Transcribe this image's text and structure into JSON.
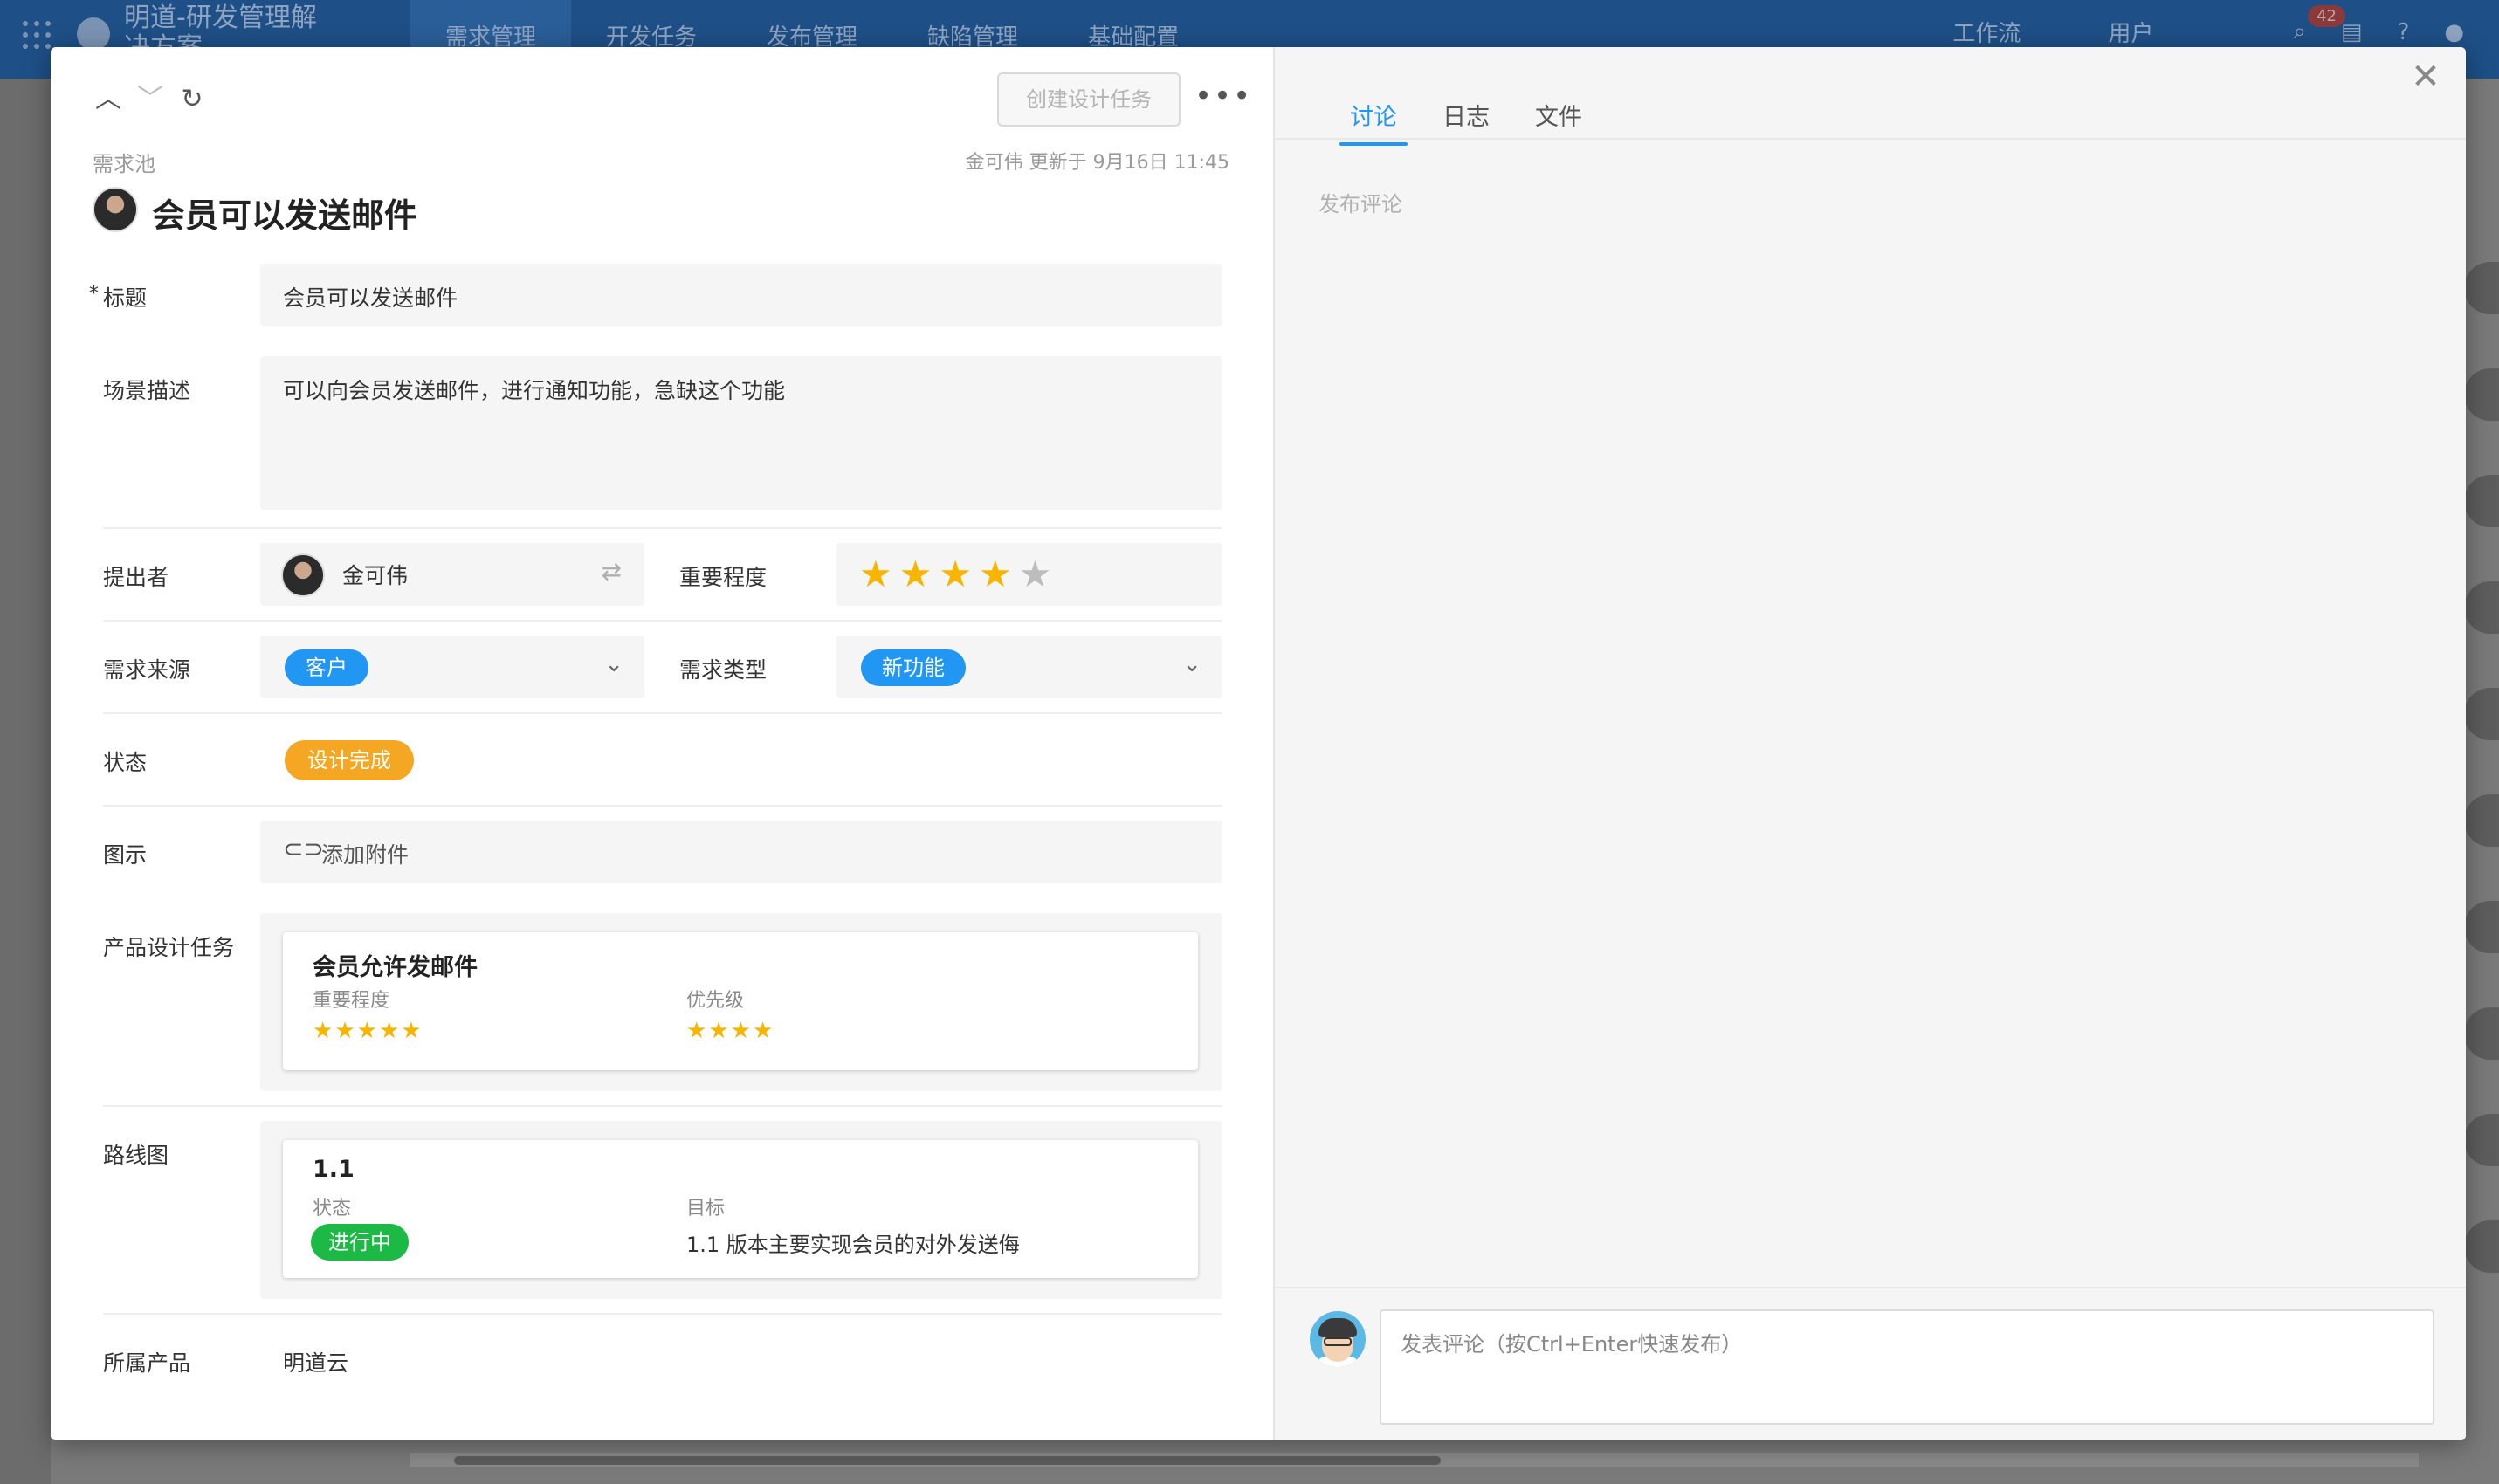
{
  "background_app": {
    "title": "明道-研发管理解决方案",
    "nav": [
      "需求管理",
      "开发任务",
      "发布管理",
      "缺陷管理",
      "基础配置"
    ],
    "right": {
      "workflow": "工作流",
      "users": "用户",
      "badge": "42"
    }
  },
  "header": {
    "create_button": "创建设计任务",
    "more_label": "•••",
    "breadcrumb": "需求池",
    "update_info": "金可伟 更新于 9月16日 11:45",
    "record_title": "会员可以发送邮件"
  },
  "form": {
    "title_field": {
      "label": "标题",
      "required_mark": "*",
      "value": "会员可以发送邮件"
    },
    "description": {
      "label": "场景描述",
      "value": "可以向会员发送邮件，进行通知功能，急缺这个功能"
    },
    "submitter": {
      "label": "提出者",
      "value": "金可伟"
    },
    "importance": {
      "label": "重要程度",
      "rating": 4,
      "max": 5
    },
    "source": {
      "label": "需求来源",
      "value": "客户"
    },
    "type": {
      "label": "需求类型",
      "value": "新功能"
    },
    "status": {
      "label": "状态",
      "value": "设计完成",
      "color": "#f5a623"
    },
    "diagram": {
      "label": "图示",
      "add_attachment": "添加附件"
    },
    "design_task": {
      "label": "产品设计任务",
      "card_title": "会员允许发邮件",
      "importance_label": "重要程度",
      "importance_rating": 5,
      "priority_label": "优先级",
      "priority_rating": 4
    },
    "roadmap": {
      "label": "路线图",
      "card_title": "1.1",
      "status_label": "状态",
      "status_value": "进行中",
      "goal_label": "目标",
      "goal_value": "1.1 版本主要实现会员的对外发送侮"
    },
    "product": {
      "label": "所属产品",
      "value": "明道云"
    }
  },
  "side": {
    "tabs": [
      "讨论",
      "日志",
      "文件"
    ],
    "active_tab": "讨论",
    "publish_hint": "发布评论",
    "comment_placeholder": "发表评论（按Ctrl+Enter快速发布）"
  },
  "colors": {
    "accent": "#2196f3",
    "star": "#f7b500",
    "in_progress": "#1db945"
  }
}
